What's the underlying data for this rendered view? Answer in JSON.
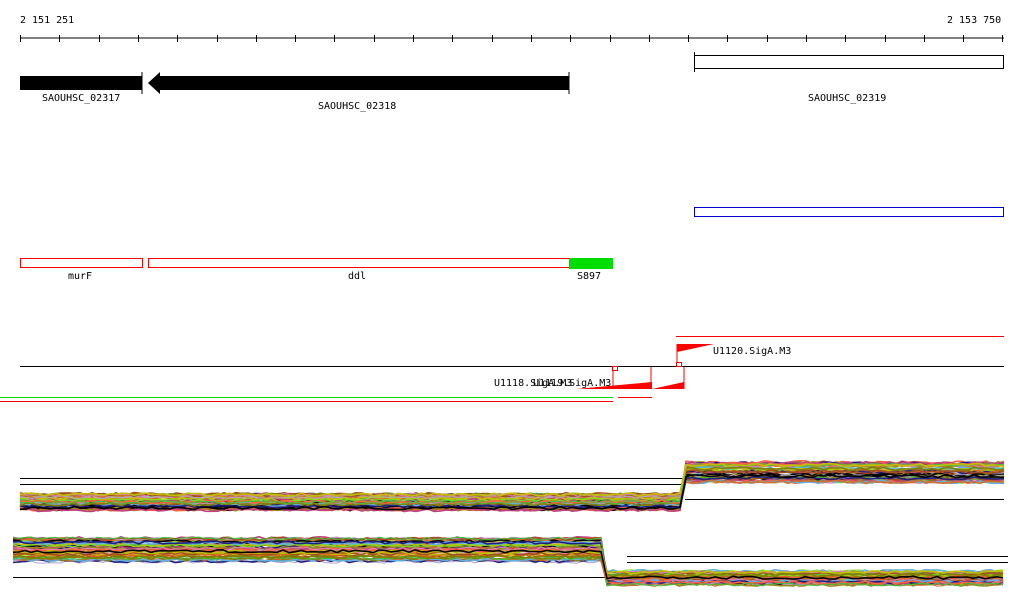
{
  "ruler": {
    "start_label": "2 151 251",
    "end_label": "2 153 750"
  },
  "genes": [
    {
      "name": "SAOUHSC_02317",
      "strand": "+"
    },
    {
      "name": "SAOUHSC_02318",
      "strand": "-"
    },
    {
      "name": "SAOUHSC_02319",
      "strand": "+"
    }
  ],
  "features": [
    {
      "name": "murF",
      "color": "#ff0000"
    },
    {
      "name": "ddl",
      "color": "#ff0000"
    },
    {
      "name": "S897",
      "color": "#00dd00"
    }
  ],
  "promoters": [
    {
      "name": "U1118.SigA.M3"
    },
    {
      "name": "U1119.SigA.M3"
    },
    {
      "name": "U1120.SigA.M3"
    }
  ],
  "colors": {
    "gene": "#000000",
    "feature_box": "#ff0000",
    "srna": "#00dd00",
    "operon_box": "#0000cc",
    "promoter": "#ff0000"
  },
  "profile_colors": [
    "#e06020",
    "#9a8a20",
    "#c04080",
    "#80e020",
    "#60b0e0",
    "#d07030",
    "#b0a0d0",
    "#a05020",
    "#202080",
    "#e080c0",
    "#808000",
    "#ff6040",
    "#40c040",
    "#c0c000",
    "#000000"
  ]
}
